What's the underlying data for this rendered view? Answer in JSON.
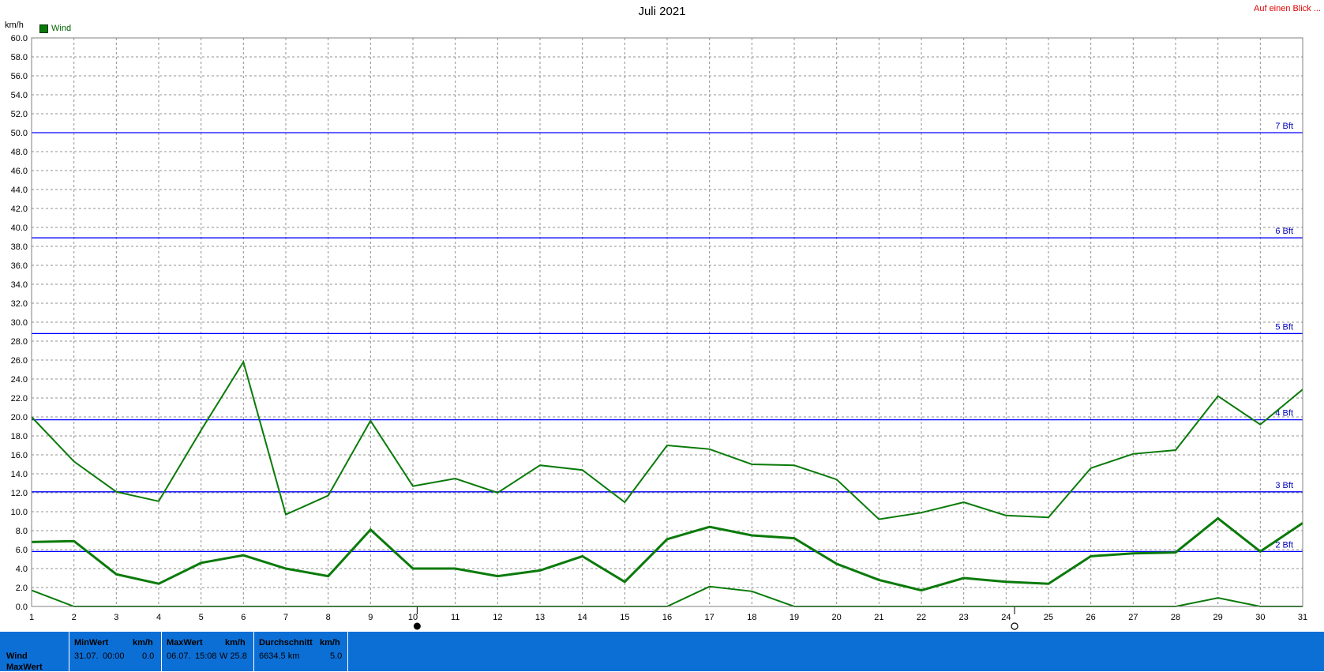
{
  "header": {
    "title": "Juli 2021",
    "link": "Auf einen Blick ...",
    "unit": "km/h",
    "legend_label": "Wind"
  },
  "colors": {
    "series": "#0a7a0a",
    "beaufort": "#0000ff",
    "grid": "#909090",
    "link": "#e00000",
    "footer_bg": "#0c6fd6"
  },
  "chart_data": {
    "type": "line",
    "title": "Juli 2021",
    "ylabel": "km/h",
    "x": [
      1,
      2,
      3,
      4,
      5,
      6,
      7,
      8,
      9,
      10,
      11,
      12,
      13,
      14,
      15,
      16,
      17,
      18,
      19,
      20,
      21,
      22,
      23,
      24,
      25,
      26,
      27,
      28,
      29,
      30,
      31
    ],
    "xlim": [
      1,
      31
    ],
    "ylim": [
      0,
      60
    ],
    "y_tick_step": 2,
    "grid": true,
    "legend": {
      "placement": "top-left",
      "entries": [
        "Wind"
      ]
    },
    "series": [
      {
        "role": "max",
        "width": 2,
        "values": [
          20.0,
          15.3,
          12.1,
          11.1,
          18.6,
          25.8,
          9.7,
          11.7,
          19.6,
          12.7,
          13.5,
          12.0,
          14.9,
          14.4,
          11.0,
          17.0,
          16.6,
          15.0,
          14.9,
          13.4,
          9.2,
          9.9,
          11.0,
          9.6,
          9.4,
          14.6,
          16.1,
          16.5,
          22.2,
          19.2,
          22.9
        ]
      },
      {
        "role": "avg",
        "width": 3,
        "values": [
          6.8,
          6.9,
          3.4,
          2.4,
          4.6,
          5.4,
          4.0,
          3.2,
          8.1,
          4.0,
          4.0,
          3.2,
          3.8,
          5.3,
          2.6,
          7.1,
          8.4,
          7.5,
          7.2,
          4.5,
          2.8,
          1.7,
          3.0,
          2.6,
          2.4,
          5.3,
          5.6,
          5.7,
          9.3,
          5.8,
          8.8
        ]
      },
      {
        "role": "min",
        "width": 2,
        "values": [
          1.7,
          0,
          0,
          0,
          0,
          0,
          0,
          0,
          0,
          0,
          0,
          0,
          0,
          0,
          0,
          0,
          2.1,
          1.6,
          0,
          0,
          0,
          0,
          0,
          0,
          0,
          0,
          0,
          0,
          0.9,
          0,
          0
        ]
      }
    ],
    "reference_lines": [
      {
        "label": "2 Bft",
        "value": 5.8
      },
      {
        "label": "3 Bft",
        "value": 12.1
      },
      {
        "label": "4 Bft",
        "value": 19.7
      },
      {
        "label": "5 Bft",
        "value": 28.8
      },
      {
        "label": "6 Bft",
        "value": 38.9
      },
      {
        "label": "7 Bft",
        "value": 50.0
      }
    ],
    "moon_markers": [
      {
        "day": 10.1,
        "phase": "new"
      },
      {
        "day": 24.2,
        "phase": "full"
      }
    ]
  },
  "footer": {
    "row_labels": [
      "Wind",
      "MaxWert"
    ],
    "min": {
      "header": "MinWert",
      "unit": "km/h",
      "date": "31.07.",
      "time": "00:00",
      "value": "0.0"
    },
    "max": {
      "header": "MaxWert",
      "unit": "km/h",
      "date": "06.07.",
      "time": "15:08",
      "dir_value": "W 25.8"
    },
    "avg": {
      "header": "Durchschnitt",
      "unit": "km/h",
      "distance": "6634.5 km",
      "value": "5.0"
    }
  }
}
